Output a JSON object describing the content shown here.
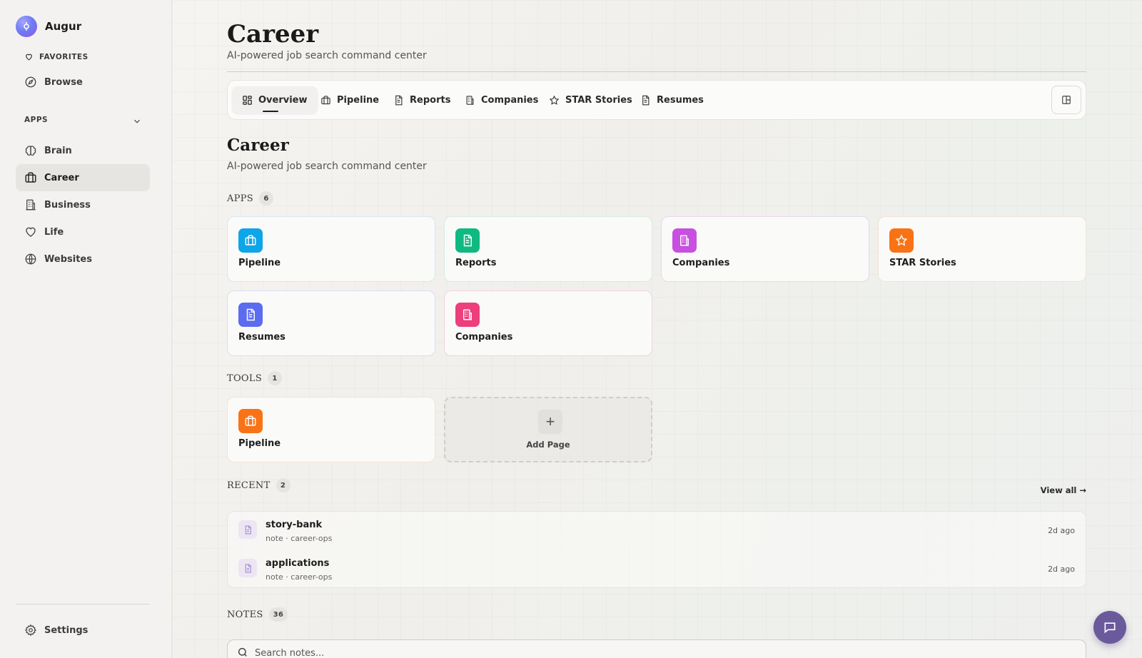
{
  "app": {
    "name": "Augur"
  },
  "sidebar": {
    "favorites_label": "FAVORITES",
    "browse_label": "Browse",
    "apps_label": "APPS",
    "items": [
      {
        "label": "Brain",
        "icon": "brain-icon"
      },
      {
        "label": "Career",
        "icon": "briefcase-icon",
        "active": true
      },
      {
        "label": "Business",
        "icon": "building-icon"
      },
      {
        "label": "Life",
        "icon": "heart-icon"
      },
      {
        "label": "Websites",
        "icon": "globe-icon"
      }
    ],
    "settings_label": "Settings"
  },
  "header": {
    "title": "Career",
    "subtitle": "AI-powered job search command center"
  },
  "tabs": [
    {
      "label": "Overview",
      "icon": "grid-icon",
      "active": true
    },
    {
      "label": "Pipeline",
      "icon": "briefcase-icon"
    },
    {
      "label": "Reports",
      "icon": "document-icon"
    },
    {
      "label": "Companies",
      "icon": "building-icon"
    },
    {
      "label": "STAR Stories",
      "icon": "star-icon"
    },
    {
      "label": "Resumes",
      "icon": "document-icon"
    }
  ],
  "overview": {
    "title": "Career",
    "subtitle": "AI-powered job search command center",
    "apps": {
      "label": "APPS",
      "count": "6",
      "items": [
        {
          "label": "Pipeline",
          "icon": "briefcase-icon",
          "color": "#0ea5e9"
        },
        {
          "label": "Reports",
          "icon": "document-icon",
          "color": "#10b981"
        },
        {
          "label": "Companies",
          "icon": "building-icon",
          "color": "#c850e0"
        },
        {
          "label": "STAR Stories",
          "icon": "star-icon",
          "color": "#f97316"
        },
        {
          "label": "Resumes",
          "icon": "document-icon",
          "color": "#5b6cf0"
        },
        {
          "label": "Companies",
          "icon": "building-icon",
          "color": "#ec3f7c"
        }
      ]
    },
    "tools": {
      "label": "TOOLS",
      "count": "1",
      "items": [
        {
          "label": "Pipeline",
          "icon": "briefcase-icon",
          "color": "#f97316"
        }
      ],
      "add_label": "Add Page"
    },
    "recent": {
      "label": "RECENT",
      "count": "2",
      "view_all": "View all →",
      "items": [
        {
          "name": "story-bank",
          "meta": "note · career-ops",
          "time": "2d ago"
        },
        {
          "name": "applications",
          "meta": "note · career-ops",
          "time": "2d ago"
        }
      ]
    },
    "notes": {
      "label": "NOTES",
      "count": "36",
      "search_placeholder": "Search notes..."
    }
  }
}
